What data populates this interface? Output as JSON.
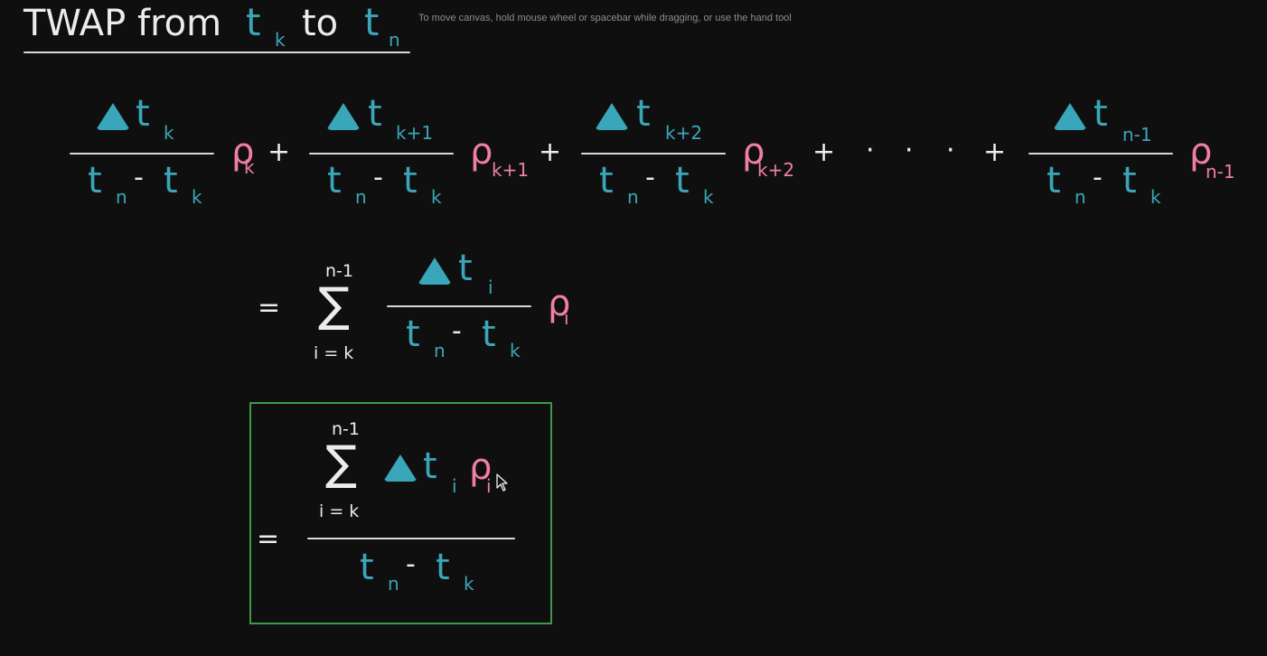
{
  "canvas": {
    "hint": "To move canvas, hold mouse wheel or spacebar while dragging, or use the hand tool"
  },
  "title": {
    "text": "TWAP from",
    "var1": "t",
    "sub1": "k",
    "mid": "to",
    "var2": "t",
    "sub2": "n"
  },
  "symbols": {
    "t": "t",
    "p": "ρ",
    "minus": "-",
    "plus": "+",
    "equals": "=",
    "dot": "·",
    "sigma": "∑",
    "sub_k": "k",
    "sub_n": "n",
    "sub_i": "i",
    "sub_k1": "k+1",
    "sub_k2": "k+2",
    "sub_n1": "n-1",
    "lower_limit": "i = k",
    "upper_limit": "n-1"
  },
  "colors": {
    "teal": "#3aa6b9",
    "pink": "#f07ea6",
    "white": "#ececec",
    "box_border": "#3e9a4a"
  }
}
